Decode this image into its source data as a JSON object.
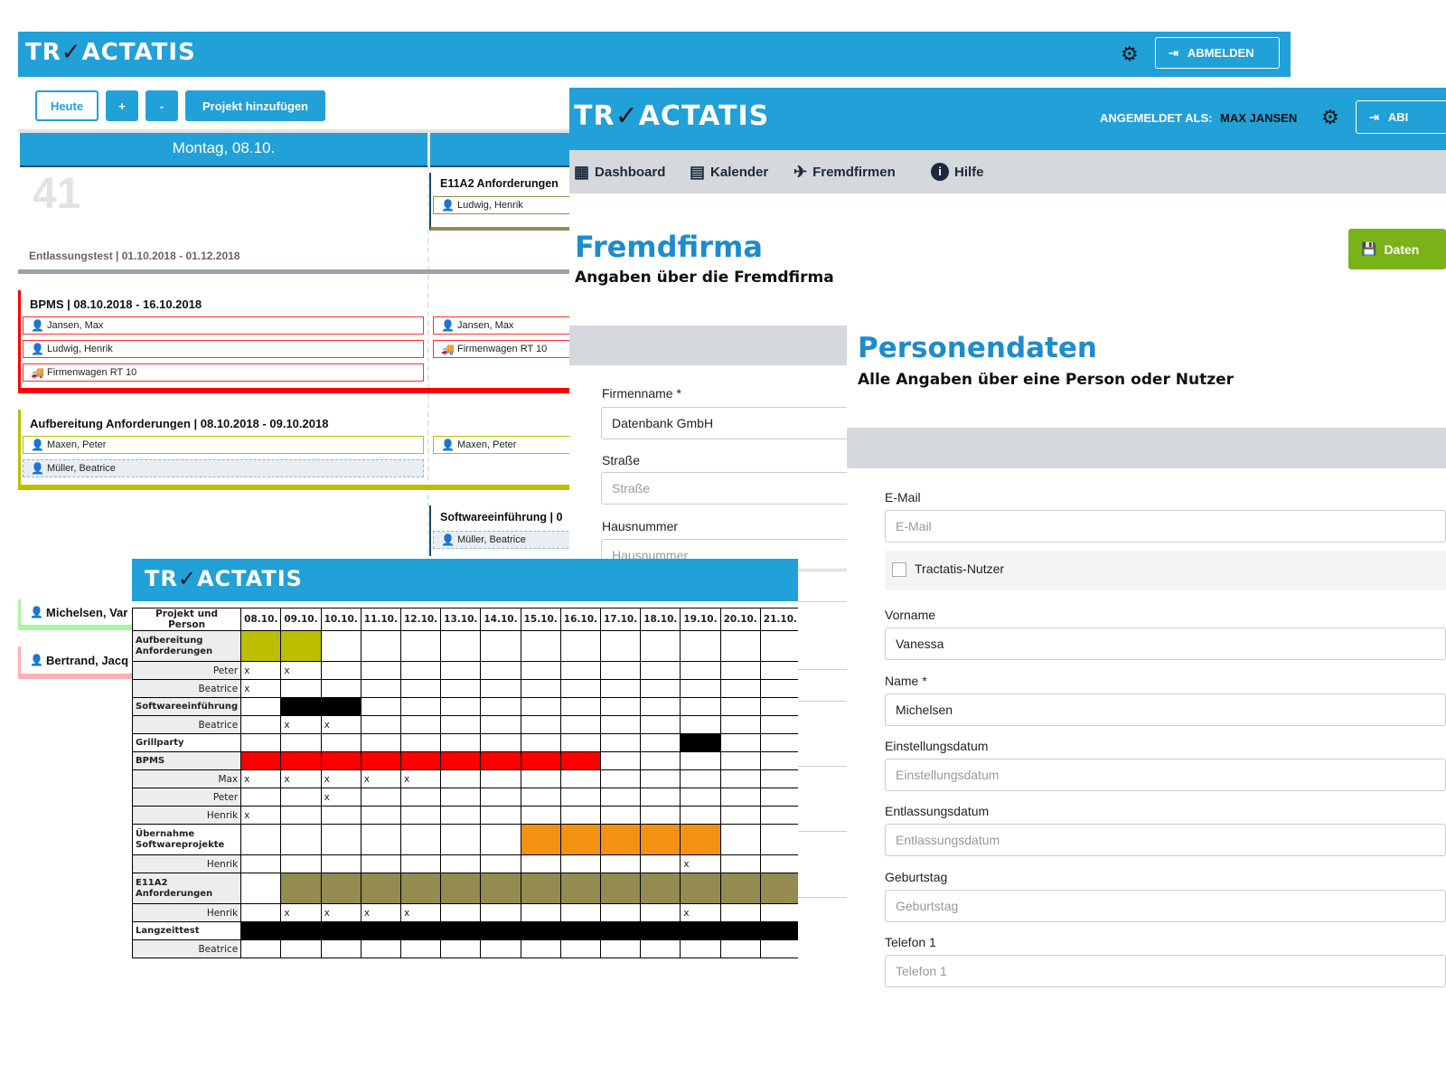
{
  "brand": {
    "logo_text_a": "TR",
    "logo_text_b": "ACTATIS",
    "logo_check": "✓",
    "color": "#22a0d8"
  },
  "calendar": {
    "logout_label": "ABMELDEN",
    "buttons": {
      "today": "Heute",
      "plus": "+",
      "minus": "-",
      "add_project": "Projekt hinzufügen"
    },
    "day1": "Montag, 08.10.",
    "week_number": "41",
    "entlassung": "Entlassungstest | 01.10.2018 - 01.12.2018",
    "e11a2": {
      "title": "E11A2 Anforderungen",
      "p1": "Ludwig, Henrik"
    },
    "bpms": {
      "title": "BPMS | 08.10.2018 - 16.10.2018",
      "p1": "Jansen, Max",
      "p2": "Ludwig, Henrik",
      "p3": "Firmenwagen RT 10",
      "r1": "Jansen, Max",
      "r2": "Firmenwagen RT 10"
    },
    "aufbereitung": {
      "title": "Aufbereitung Anforderungen | 08.10.2018 - 09.10.2018",
      "p1": "Maxen, Peter",
      "p2": "Müller, Beatrice",
      "r1": "Maxen, Peter"
    },
    "software": {
      "title": "Softwareeinführung | 0",
      "p1": "Müller, Beatrice"
    },
    "michelsen": "Michelsen, Var",
    "bertrand": "Bertrand, Jacq"
  },
  "gantt": {
    "header": [
      "Projekt und Person",
      "08.10.",
      "09.10.",
      "10.10.",
      "11.10.",
      "12.10.",
      "13.10.",
      "14.10.",
      "15.10.",
      "16.10.",
      "17.10.",
      "18.10.",
      "19.10.",
      "20.10.",
      "21.10."
    ],
    "rows": [
      {
        "label": "Aufbereitung Anforderungen",
        "type": "project",
        "fill": [
          0,
          1
        ],
        "color": "#bcbe00",
        "tall": true
      },
      {
        "label": "Peter",
        "type": "person",
        "marks": [
          0,
          1
        ]
      },
      {
        "label": "Beatrice",
        "type": "person",
        "marks": [
          0
        ]
      },
      {
        "label": "Softwareeinführung",
        "type": "project",
        "fill": [
          1,
          2
        ],
        "color": "#000000"
      },
      {
        "label": "Beatrice",
        "type": "person",
        "marks": [
          1,
          2
        ]
      },
      {
        "label": "Grillparty",
        "type": "projectw",
        "fill": [
          11
        ],
        "color": "#000000"
      },
      {
        "label": "BPMS",
        "type": "project",
        "fill": [
          0,
          1,
          2,
          3,
          4,
          5,
          6,
          7,
          8
        ],
        "color": "#ff0000"
      },
      {
        "label": "Max",
        "type": "person",
        "marks": [
          0,
          1,
          2,
          3,
          4
        ]
      },
      {
        "label": "Peter",
        "type": "person",
        "marks": [
          2
        ]
      },
      {
        "label": "Henrik",
        "type": "person",
        "marks": [
          0
        ]
      },
      {
        "label": "Übernahme Softwareprojekte",
        "type": "projectw",
        "fill": [
          7,
          8,
          9,
          10,
          11
        ],
        "color": "#f39110",
        "tall": true
      },
      {
        "label": "Henrik",
        "type": "person",
        "marks": [
          11
        ]
      },
      {
        "label": "E11A2 Anforderungen",
        "type": "project",
        "fill": [
          1,
          2,
          3,
          4,
          5,
          6,
          7,
          8,
          9,
          10,
          11,
          12,
          13
        ],
        "color": "#938b50",
        "tall": true
      },
      {
        "label": "Henrik",
        "type": "person",
        "marks": [
          1,
          2,
          3,
          4,
          11
        ]
      },
      {
        "label": "Langzeittest",
        "type": "projectw",
        "fill": [
          0,
          1,
          2,
          3,
          4,
          5,
          6,
          7,
          8,
          9,
          10,
          11,
          12,
          13
        ],
        "color": "#000000"
      },
      {
        "label": "Beatrice",
        "type": "person",
        "marks": []
      }
    ],
    "mark": "x"
  },
  "detail": {
    "logged_in_label": "ANGEMELDET ALS:",
    "user": "MAX JANSEN",
    "logout_label": "ABI",
    "nav": {
      "dashboard": "Dashboard",
      "kalender": "Kalender",
      "fremdfirmen": "Fremdfirmen",
      "hilfe": "Hilfe"
    },
    "fremdfirma_title": "Fremdfirma",
    "fremdfirma_sub": "Angaben über die Fremdfirma",
    "save_label": "Daten",
    "firmenname_label": "Firmenname *",
    "firmenname_value": "Datenbank GmbH",
    "strasse_label": "Straße",
    "strasse_placeholder": "Straße",
    "hausnummer_label": "Hausnummer",
    "hausnummer_placeholder": "Hausnummer",
    "personen_title": "Personendaten",
    "personen_sub": "Alle Angaben über eine Person oder Nutzer",
    "email_label": "E-Mail",
    "email_placeholder": "E-Mail",
    "nutzer_label": "Tractatis-Nutzer",
    "vorname_label": "Vorname",
    "vorname_value": "Vanessa",
    "name_label": "Name *",
    "name_value": "Michelsen",
    "einstellung_label": "Einstellungsdatum",
    "einstellung_placeholder": "Einstellungsdatum",
    "entlassung_label": "Entlassungsdatum",
    "entlassung_placeholder": "Entlassungsdatum",
    "geburtstag_label": "Geburtstag",
    "geburtstag_placeholder": "Geburtstag",
    "telefon_label": "Telefon 1",
    "telefon_placeholder": "Telefon 1"
  }
}
